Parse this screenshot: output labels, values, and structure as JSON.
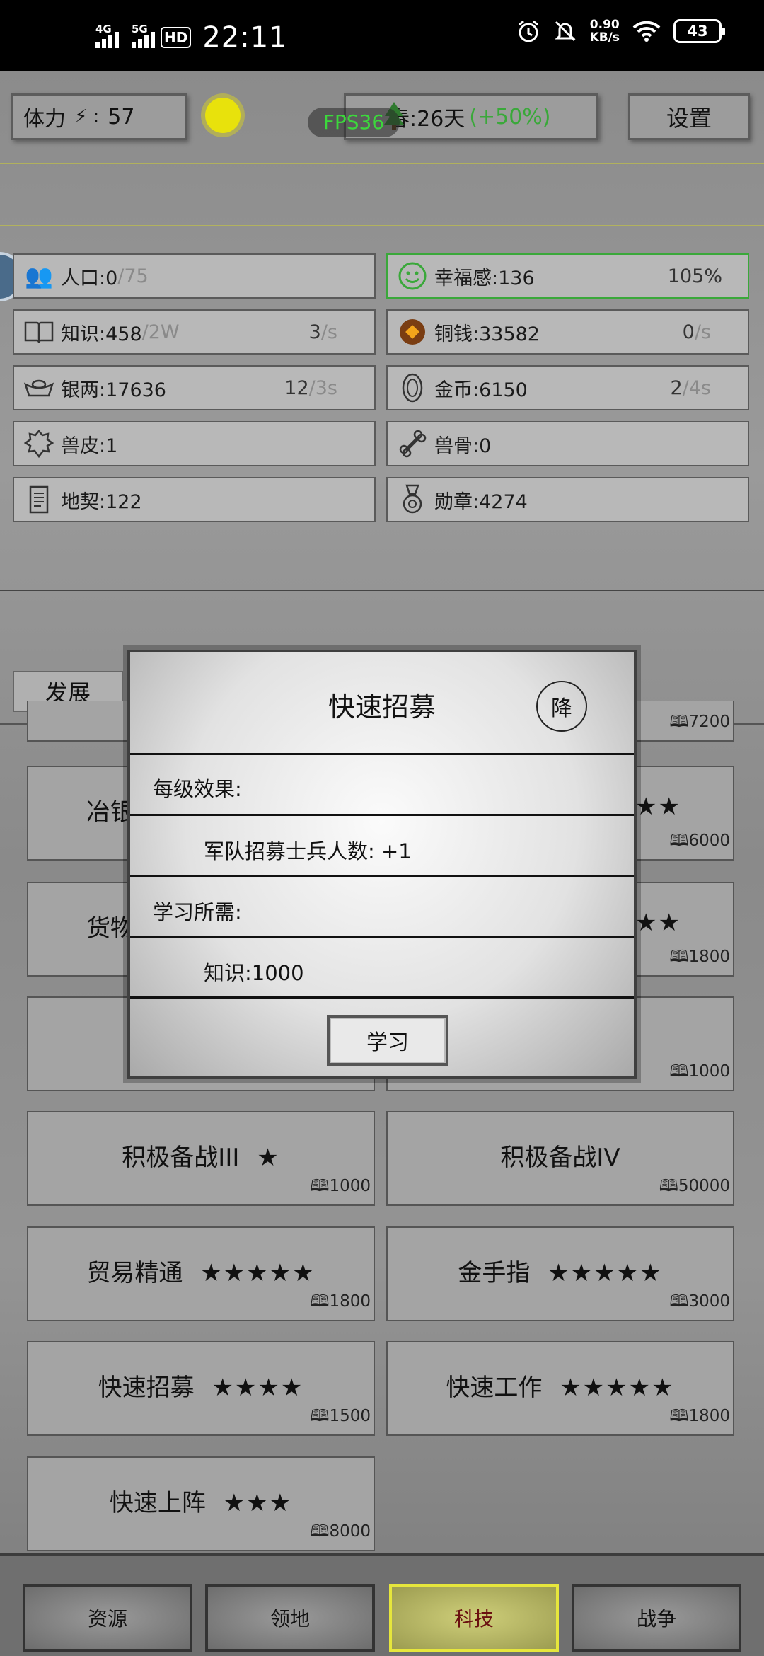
{
  "status_bar": {
    "signal1": "4G",
    "signal2": "5G",
    "hd": "HD",
    "time": "22:11",
    "net_speed": "0.90",
    "net_unit": "KB/s",
    "battery": "43"
  },
  "top_bar": {
    "stamina_label": "体力",
    "stamina_sep": "⚡ :",
    "stamina_value": "57",
    "fps": "FPS36",
    "season": "春:26天",
    "season_bonus": "(+50%)",
    "settings": "设置"
  },
  "resources": {
    "population_label": "人口:0",
    "population_max": "/75",
    "happiness": "幸福感:136",
    "happiness_pct": "105%",
    "knowledge_label": "知识:458",
    "knowledge_max": "/2W",
    "knowledge_rate_num": "3",
    "knowledge_rate_unit": "/s",
    "copper": "铜钱:33582",
    "copper_rate_num": "0",
    "copper_rate_unit": "/s",
    "silver": "银两:17636",
    "silver_rate_num": "12",
    "silver_rate_unit": "/3s",
    "gold": "金币:6150",
    "gold_rate_num": "2",
    "gold_rate_unit": "/4s",
    "hide": "兽皮:1",
    "bone": "兽骨:0",
    "deed": "地契:122",
    "medal": "勋章:4274"
  },
  "tab": {
    "develop": "发展"
  },
  "tech_cards": [
    {
      "name": "",
      "stars": "",
      "cost": "7200"
    },
    {
      "name": "冶银",
      "stars": "★★",
      "cost": "6000"
    },
    {
      "name": "货物",
      "stars": "★★",
      "cost": "1800"
    },
    {
      "name": "",
      "stars": "",
      "cost": "1000",
      "cost2": "1000"
    },
    {
      "name": "积极备战III",
      "stars": "★",
      "cost": "1000"
    },
    {
      "name": "积极备战IV",
      "stars": "",
      "cost": "50000"
    },
    {
      "name": "贸易精通",
      "stars": "★★★★★",
      "cost": "1800"
    },
    {
      "name": "金手指",
      "stars": "★★★★★",
      "cost": "3000"
    },
    {
      "name": "快速招募",
      "stars": "★★★★",
      "cost": "1500"
    },
    {
      "name": "快速工作",
      "stars": "★★★★★",
      "cost": "1800"
    },
    {
      "name": "快速上阵",
      "stars": "★★★",
      "cost": "8000"
    }
  ],
  "bottom_nav": {
    "resources": "资源",
    "territory": "领地",
    "tech": "科技",
    "war": "战争"
  },
  "modal": {
    "title": "快速招募",
    "downgrade": "降",
    "effect_label": "每级效果:",
    "effect_value": "军队招募士兵人数: +1",
    "require_label": "学习所需:",
    "require_value": "知识:1000",
    "learn_button": "学习"
  }
}
